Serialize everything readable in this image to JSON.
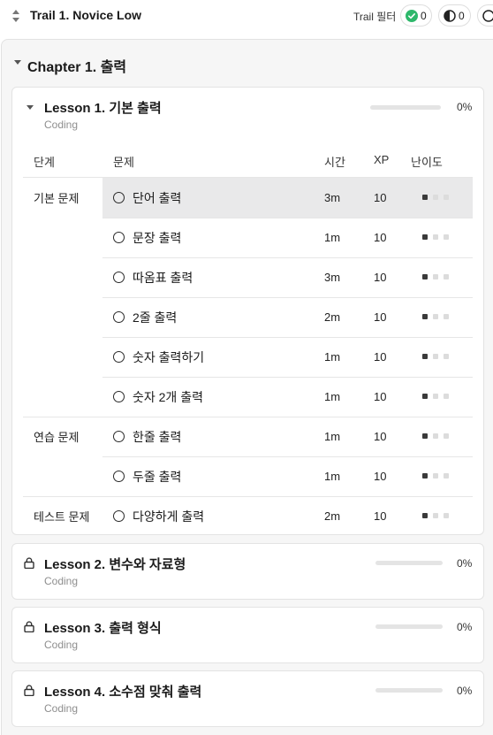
{
  "header": {
    "trail_title": "Trail 1. Novice Low",
    "filter_label": "Trail 필터",
    "filters": [
      {
        "icon": "check-circle-icon",
        "count": "0"
      },
      {
        "icon": "half-circle-icon",
        "count": "0"
      },
      {
        "icon": "empty-circle-icon",
        "count": ""
      }
    ]
  },
  "chapter": {
    "title": "Chapter 1. 출력"
  },
  "lessons": [
    {
      "title": "Lesson 1. 기본 출력",
      "subtitle": "Coding",
      "progress_pct": 0,
      "progress_text": "0%",
      "expanded": true
    },
    {
      "title": "Lesson 2. 변수와 자료형",
      "subtitle": "Coding",
      "progress_pct": 0,
      "progress_text": "0%",
      "locked": true
    },
    {
      "title": "Lesson 3. 출력 형식",
      "subtitle": "Coding",
      "progress_pct": 0,
      "progress_text": "0%",
      "locked": true
    },
    {
      "title": "Lesson 4. 소수점 맞춰 출력",
      "subtitle": "Coding",
      "progress_pct": 0,
      "progress_text": "0%",
      "locked": true
    }
  ],
  "table": {
    "headers": {
      "stage": "단계",
      "problem": "문제",
      "time": "시간",
      "xp": "XP",
      "difficulty": "난이도"
    },
    "stages": [
      "기본 문제",
      "연습 문제",
      "테스트 문제"
    ],
    "rows": [
      {
        "title": "단어 출력",
        "time": "3m",
        "xp": "10",
        "difficulty": 1,
        "selected": true
      },
      {
        "title": "문장 출력",
        "time": "1m",
        "xp": "10",
        "difficulty": 1
      },
      {
        "title": "따옴표 출력",
        "time": "3m",
        "xp": "10",
        "difficulty": 1
      },
      {
        "title": "2줄 출력",
        "time": "2m",
        "xp": "10",
        "difficulty": 1
      },
      {
        "title": "숫자 출력하기",
        "time": "1m",
        "xp": "10",
        "difficulty": 1
      },
      {
        "title": "숫자 2개 출력",
        "time": "1m",
        "xp": "10",
        "difficulty": 1
      },
      {
        "title": "한줄 출력",
        "time": "1m",
        "xp": "10",
        "difficulty": 1
      },
      {
        "title": "두줄 출력",
        "time": "1m",
        "xp": "10",
        "difficulty": 1
      },
      {
        "title": "다양하게 출력",
        "time": "2m",
        "xp": "10",
        "difficulty": 1
      }
    ],
    "difficulty_max": 3
  },
  "colors": {
    "accent_green": "#2eb86b",
    "selected_row": "#e9e9ea",
    "panel_bg": "#f6f6f6"
  }
}
